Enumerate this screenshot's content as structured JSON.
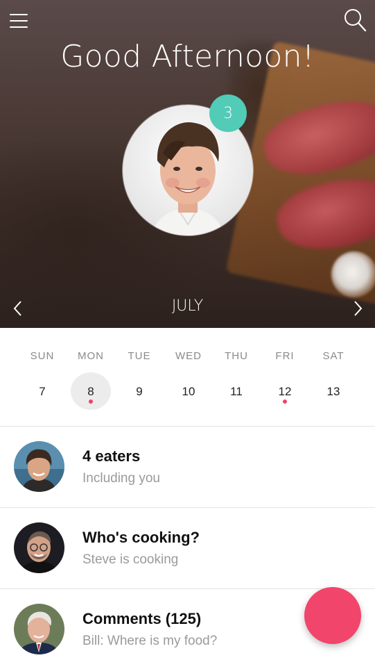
{
  "header": {
    "greeting": "Good Afternoon!",
    "badge_count": "3",
    "month": "JULY",
    "icons": {
      "menu": "hamburger-menu-icon",
      "search": "search-icon",
      "prev": "chevron-left-icon",
      "next": "chevron-right-icon"
    }
  },
  "calendar": {
    "days": [
      {
        "name": "SUN",
        "date": "7",
        "selected": false,
        "has_event": false
      },
      {
        "name": "MON",
        "date": "8",
        "selected": true,
        "has_event": true
      },
      {
        "name": "TUE",
        "date": "9",
        "selected": false,
        "has_event": false
      },
      {
        "name": "WED",
        "date": "10",
        "selected": false,
        "has_event": false
      },
      {
        "name": "THU",
        "date": "11",
        "selected": false,
        "has_event": false
      },
      {
        "name": "FRI",
        "date": "12",
        "selected": false,
        "has_event": true
      },
      {
        "name": "SAT",
        "date": "13",
        "selected": false,
        "has_event": false
      }
    ]
  },
  "list": [
    {
      "title": "4 eaters",
      "subtitle": "Including you"
    },
    {
      "title": "Who's cooking?",
      "subtitle": "Steve is cooking"
    },
    {
      "title": "Comments (125)",
      "subtitle": "Bill: Where is my food?"
    }
  ],
  "colors": {
    "accent": "#f2456b",
    "badge": "#52cbb7",
    "event_dot": "#f0416a"
  }
}
